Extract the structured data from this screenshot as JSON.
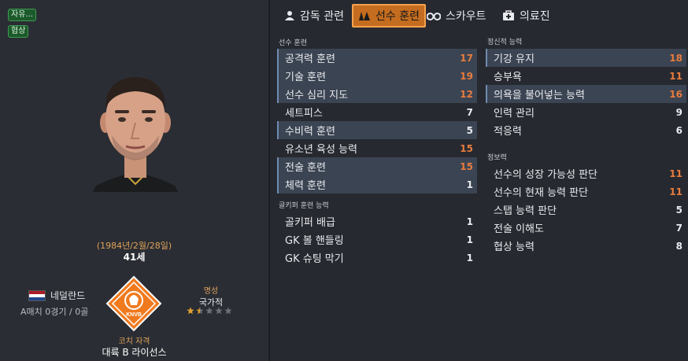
{
  "tags": [
    "자유...",
    "협상"
  ],
  "profile": {
    "birthdate": "(1984년/2월/28일)",
    "age": "41세",
    "nationality": "네덜란드",
    "caps": "A매치 0경기 / 0골",
    "reputation_label": "명성",
    "reputation_value": "국가적",
    "reputation_stars": 1.5,
    "coach_badge_label": "코치 자격",
    "coach_badge_value": "대륙 B 라이선스",
    "badge_text": "KNVB"
  },
  "tabs": [
    {
      "label": "감독 관련",
      "icon": "people-icon",
      "active": false
    },
    {
      "label": "선수 훈련",
      "icon": "cones-icon",
      "active": true
    },
    {
      "label": "스카우트",
      "icon": "binoculars-icon",
      "active": false
    },
    {
      "label": "의료진",
      "icon": "medkit-icon",
      "active": false
    }
  ],
  "sections": {
    "training": {
      "title": "선수 훈련",
      "rows": [
        {
          "label": "공격력 훈련",
          "value": "17",
          "hl": true,
          "high": true
        },
        {
          "label": "기술 훈련",
          "value": "19",
          "hl": true,
          "high": true
        },
        {
          "label": "선수 심리 지도",
          "value": "12",
          "hl": true,
          "high": true
        },
        {
          "label": "세트피스",
          "value": "7",
          "hl": false,
          "high": false
        },
        {
          "label": "수비력 훈련",
          "value": "5",
          "hl": true,
          "high": false
        },
        {
          "label": "유소년 육성 능력",
          "value": "15",
          "hl": false,
          "high": true
        },
        {
          "label": "전술 훈련",
          "value": "15",
          "hl": true,
          "high": true
        },
        {
          "label": "체력 훈련",
          "value": "1",
          "hl": true,
          "high": false
        }
      ]
    },
    "goalkeeping": {
      "title": "골키퍼 훈련 능력",
      "rows": [
        {
          "label": "골키퍼 배급",
          "value": "1",
          "hl": false,
          "high": false
        },
        {
          "label": "GK 볼 핸들링",
          "value": "1",
          "hl": false,
          "high": false
        },
        {
          "label": "GK 슈팅 막기",
          "value": "1",
          "hl": false,
          "high": false
        }
      ]
    },
    "mental": {
      "title": "정신적 능력",
      "rows": [
        {
          "label": "기강 유지",
          "value": "18",
          "hl": true,
          "high": true
        },
        {
          "label": "승부욕",
          "value": "11",
          "hl": false,
          "high": true
        },
        {
          "label": "의욕을 불어넣는 능력",
          "value": "16",
          "hl": true,
          "high": true
        },
        {
          "label": "인력 관리",
          "value": "9",
          "hl": false,
          "high": false
        },
        {
          "label": "적응력",
          "value": "6",
          "hl": false,
          "high": false
        }
      ]
    },
    "knowledge": {
      "title": "정보력",
      "rows": [
        {
          "label": "선수의 성장 가능성 판단",
          "value": "11",
          "hl": false,
          "high": true
        },
        {
          "label": "선수의 현재 능력 판단",
          "value": "11",
          "hl": false,
          "high": true
        },
        {
          "label": "스탭 능력 판단",
          "value": "5",
          "hl": false,
          "high": false
        },
        {
          "label": "전술 이해도",
          "value": "7",
          "hl": false,
          "high": false
        },
        {
          "label": "협상 능력",
          "value": "8",
          "hl": false,
          "high": false
        }
      ]
    }
  },
  "colors": {
    "high_value": "#e87c3e",
    "accent": "#c46c1f",
    "flag": [
      "#ae1c28",
      "#ffffff",
      "#21468b"
    ]
  }
}
